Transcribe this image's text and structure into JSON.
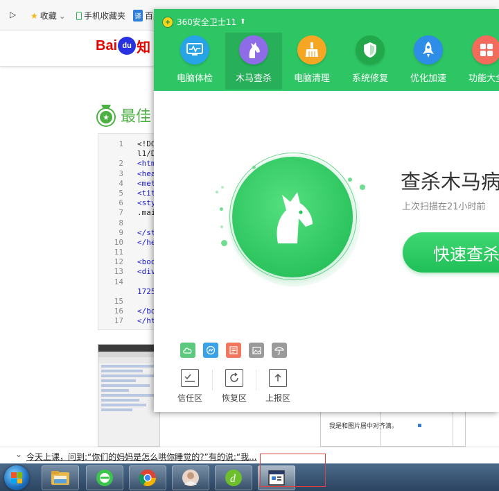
{
  "browser": {
    "collapse_glyph": "▷",
    "bookmarks": [
      {
        "label": "收藏",
        "icon": "star-icon",
        "arrow": "⌄"
      },
      {
        "label": "手机收藏夹",
        "icon": "phone-icon"
      },
      {
        "label": "百度",
        "icon": "translate-icon",
        "badge": "译"
      }
    ],
    "logo": {
      "part1": "Bai",
      "paw": "du",
      "part2": "知"
    },
    "answer_title": "最佳",
    "code_lines": {
      "numbers": [
        "1",
        "",
        "2",
        "3",
        "4",
        "5",
        "6",
        "7",
        "8",
        "9",
        "10",
        "11",
        "12",
        "13",
        "14",
        "",
        "15",
        "16",
        "17"
      ],
      "text": [
        "<!DO",
        "l1/D",
        "<htm",
        "<hea",
        "<met",
        "<tit",
        "<sty",
        ".mai",
        "",
        "</st",
        "</he",
        "",
        "<boo",
        "<div",
        "",
        "1725",
        "",
        "</bo",
        "</ht"
      ]
    },
    "right_cell_text": "我是和图片居中对齐滴。"
  },
  "app_360": {
    "title": "360安全卫士11",
    "up_arrow": "⬆",
    "logo_glyph": "+",
    "nav": [
      {
        "label": "电脑体检",
        "color": "#27a4e8"
      },
      {
        "label": "木马查杀",
        "color": "#8e6ce8"
      },
      {
        "label": "电脑清理",
        "color": "#f5a623"
      },
      {
        "label": "系统修复",
        "color": "#22a84a"
      },
      {
        "label": "优化加速",
        "color": "#2e8de6"
      },
      {
        "label": "功能大全",
        "color": "#f26b5b"
      }
    ],
    "scan": {
      "title": "查杀木马病",
      "subtitle": "上次扫描在21小时前",
      "button": "快速查杀"
    },
    "mini_icons": [
      {
        "name": "cloud-icon",
        "color": "#5cc97f"
      },
      {
        "name": "chart-icon",
        "color": "#3aa2e8"
      },
      {
        "name": "list-icon",
        "color": "#f1785e"
      },
      {
        "name": "image-icon",
        "color": "#9a9a9a"
      },
      {
        "name": "umbrella-icon",
        "color": "#9a9a9a"
      }
    ],
    "zones": [
      {
        "label": "信任区"
      },
      {
        "label": "恢复区"
      },
      {
        "label": "上报区"
      }
    ]
  },
  "notification": {
    "chevron": "⌄",
    "text": "今天上课，问到:“你们的妈妈是怎么哄你睡觉的?”有的说:“我..."
  },
  "colors": {
    "green": "#2ec564",
    "green_dark": "#27b059"
  }
}
